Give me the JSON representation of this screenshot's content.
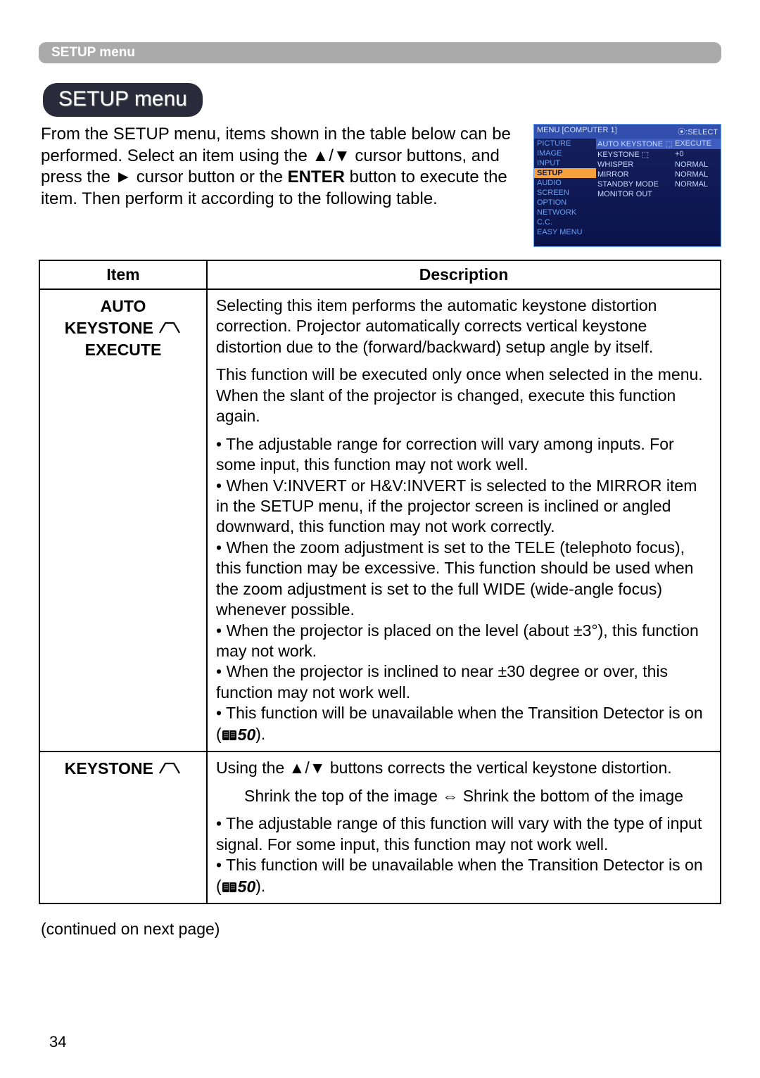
{
  "sectionBar": "SETUP menu",
  "pill": "SETUP menu",
  "intro": "From the SETUP menu, items shown in the table below can be performed.\nSelect an item using the ▲/▼ cursor buttons, and press the ► cursor button or the <b>ENTER</b> button to execute the item. Then perform it according to the following table.",
  "osd": {
    "topLeft": "MENU [COMPUTER 1]",
    "topRight": "⦿:SELECT",
    "left": [
      "PICTURE",
      "IMAGE",
      "INPUT",
      "SETUP",
      "AUDIO",
      "SCREEN",
      "OPTION",
      "NETWORK",
      "C.C.",
      "EASY MENU"
    ],
    "selectedLeft": "SETUP",
    "right": [
      {
        "c1": "AUTO KEYSTONE ⬚",
        "c2": "EXECUTE",
        "sel": true
      },
      {
        "c1": "KEYSTONE ⬚",
        "c2": "+0"
      },
      {
        "c1": "WHISPER",
        "c2": "NORMAL"
      },
      {
        "c1": "MIRROR",
        "c2": "NORMAL"
      },
      {
        "c1": "STANDBY MODE",
        "c2": "NORMAL"
      },
      {
        "c1": "MONITOR OUT",
        "c2": ""
      }
    ]
  },
  "table": {
    "headers": {
      "item": "Item",
      "desc": "Description"
    },
    "rows": [
      {
        "item": {
          "line1": "AUTO",
          "line2": "KEYSTONE",
          "trapezoid": true,
          "line3": "EXECUTE"
        },
        "desc": [
          {
            "type": "p",
            "text": "Selecting this item performs the automatic keystone distortion correction. Projector automatically corrects vertical keystone distortion due to the (forward/backward) setup angle by itself."
          },
          {
            "type": "p",
            "text": "This function will be executed only once when selected in the menu. When the slant of the projector is changed, execute this function again."
          },
          {
            "type": "p",
            "text": "• The adjustable range for correction will vary among inputs. For some input, this function may not work well.\n• When V:INVERT or H&V:INVERT is selected to the MIRROR item in the SETUP menu, if the projector screen is inclined or angled downward, this function may not work correctly.\n• When the zoom adjustment is set to the TELE (telephoto focus), this function may be excessive. This function should be used when the zoom adjustment is set to the full WIDE (wide-angle focus) whenever possible.\n• When the projector is placed on the level (about ±3°), this function may not work.\n• When the projector is inclined to near ±30 degree or over, this function may not work well.\n• This function will be unavailable when the Transition Detector is on (📖<b><i>50</i></b>)."
          }
        ]
      },
      {
        "item": {
          "line1": "KEYSTONE",
          "trapezoid": true,
          "inline": true
        },
        "desc": [
          {
            "type": "p",
            "text": "Using the ▲/▼ buttons corrects the vertical keystone distortion."
          },
          {
            "type": "center",
            "text": "Shrink the top of the image ⇔ Shrink the bottom of the image"
          },
          {
            "type": "p",
            "text": "• The adjustable range of this function will vary with the type of input signal. For some input, this function may not work well.\n• This function will be unavailable when the Transition Detector is on (📖<b><i>50</i></b>)."
          }
        ]
      }
    ]
  },
  "continued": "(continued on next page)",
  "pageNumber": "34"
}
